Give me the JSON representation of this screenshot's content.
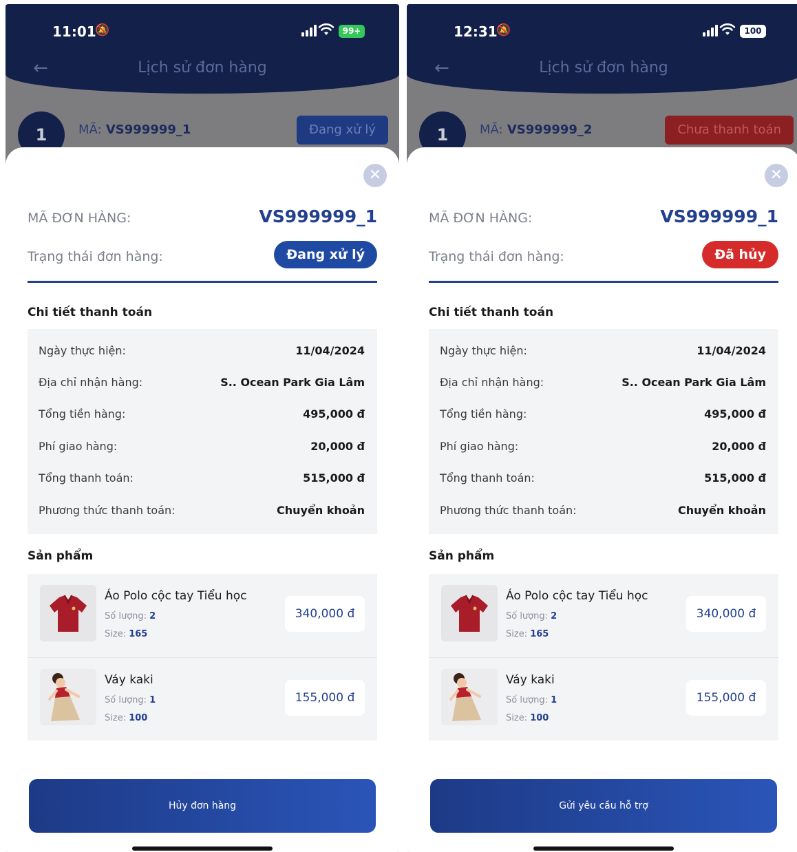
{
  "screens": [
    {
      "status_bar": {
        "time": "11:01",
        "battery": "99+"
      },
      "header_title": "Lịch sử đơn hàng",
      "background_order": {
        "number": "1",
        "code_label": "MÃ:",
        "code": "VS999999_1",
        "status": "Đang xử lý"
      },
      "sheet": {
        "order_code_label": "MÃ ĐƠN HÀNG:",
        "order_code": "VS999999_1",
        "status_label": "Trạng thái đơn hàng:",
        "status": "Đang xử lý",
        "status_color": "#1f4aa3",
        "payment_title": "Chi tiết thanh toán",
        "payment": [
          {
            "label": "Ngày thực hiện:",
            "value": "11/04/2024"
          },
          {
            "label": "Địa chỉ nhận hàng:",
            "value": "S.. Ocean Park Gia Lâm"
          },
          {
            "label": "Tổng tiền hàng:",
            "value": "495,000 đ"
          },
          {
            "label": "Phí giao hàng:",
            "value": "20,000 đ"
          },
          {
            "label": "Tổng thanh toán:",
            "value": "515,000 đ"
          },
          {
            "label": "Phương thức thanh toán:",
            "value": "Chuyển khoản"
          }
        ],
        "products_title": "Sản phẩm",
        "products": [
          {
            "name": "Áo Polo cộc tay Tiểu học",
            "qty_label": "Số lượng:",
            "qty": "2",
            "size_label": "Size:",
            "size": "165",
            "price": "340,000 đ",
            "image": "red-polo-shirt"
          },
          {
            "name": "Váy kaki",
            "qty_label": "Số lượng:",
            "qty": "1",
            "size_label": "Size:",
            "size": "100",
            "price": "155,000 đ",
            "image": "girl-in-kaki-dress"
          }
        ],
        "action_label": "Hủy đơn hàng"
      }
    },
    {
      "status_bar": {
        "time": "12:31",
        "battery": "100"
      },
      "header_title": "Lịch sử đơn hàng",
      "background_order": {
        "number": "1",
        "code_label": "MÃ:",
        "code": "VS999999_2",
        "status": "Chưa thanh toán"
      },
      "sheet": {
        "order_code_label": "MÃ ĐƠN HÀNG:",
        "order_code": "VS999999_1",
        "status_label": "Trạng thái đơn hàng:",
        "status": "Đã hủy",
        "status_color": "#d52b2b",
        "payment_title": "Chi tiết thanh toán",
        "payment": [
          {
            "label": "Ngày thực hiện:",
            "value": "11/04/2024"
          },
          {
            "label": "Địa chỉ nhận hàng:",
            "value": "S.. Ocean Park Gia Lâm"
          },
          {
            "label": "Tổng tiền hàng:",
            "value": "495,000 đ"
          },
          {
            "label": "Phí giao hàng:",
            "value": "20,000 đ"
          },
          {
            "label": "Tổng thanh toán:",
            "value": "515,000 đ"
          },
          {
            "label": "Phương thức thanh toán:",
            "value": "Chuyển khoản"
          }
        ],
        "products_title": "Sản phẩm",
        "products": [
          {
            "name": "Áo Polo cộc tay Tiểu học",
            "qty_label": "Số lượng:",
            "qty": "2",
            "size_label": "Size:",
            "size": "165",
            "price": "340,000 đ",
            "image": "red-polo-shirt"
          },
          {
            "name": "Váy kaki",
            "qty_label": "Số lượng:",
            "qty": "1",
            "size_label": "Size:",
            "size": "100",
            "price": "155,000 đ",
            "image": "girl-in-kaki-dress"
          }
        ],
        "action_label": "Gửi yêu cầu hỗ trợ"
      }
    }
  ]
}
